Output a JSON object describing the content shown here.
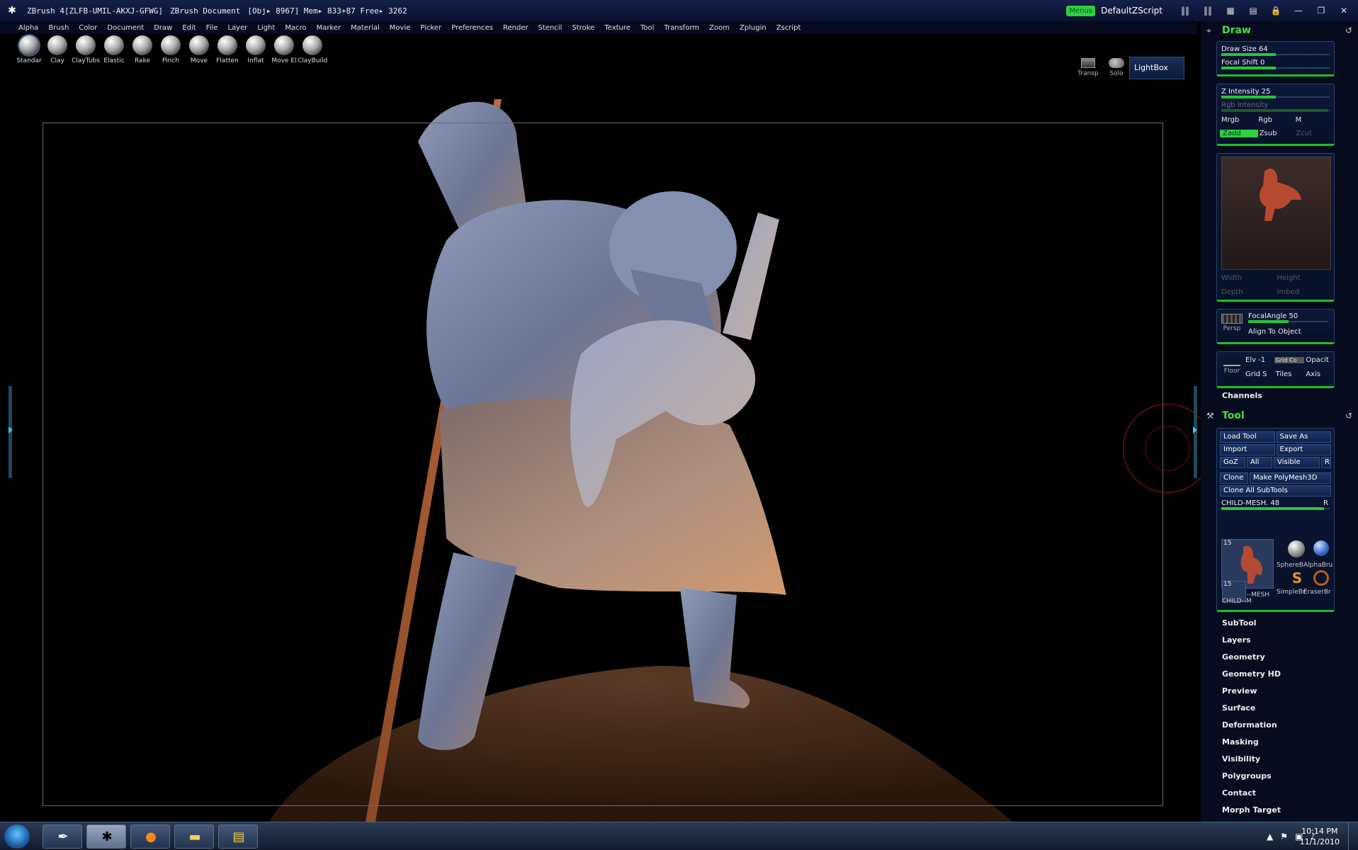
{
  "title": {
    "app": "ZBrush 4[ZLFB-UMIL-AKXJ-GFWG]",
    "doc": "ZBrush Document",
    "stats": "[Obj▸ 8967] Mem▸ 833+87 Free▸ 3262",
    "menus_badge": "Menus",
    "script": "DefaultZScript"
  },
  "menubar": [
    "Alpha",
    "Brush",
    "Color",
    "Document",
    "Draw",
    "Edit",
    "File",
    "Layer",
    "Light",
    "Macro",
    "Marker",
    "Material",
    "Movie",
    "Picker",
    "Preferences",
    "Render",
    "Stencil",
    "Stroke",
    "Texture",
    "Tool",
    "Transform",
    "Zoom",
    "Zplugin",
    "Zscript"
  ],
  "brushes": [
    "Standar",
    "Clay",
    "ClayTubs",
    "Elastic",
    "Rake",
    "Pinch",
    "Move",
    "Flatten",
    "Inflat",
    "Move El",
    "ClayBuild"
  ],
  "topbar": {
    "transp": "Transp",
    "solo": "Solo",
    "lightbox": "LightBox"
  },
  "draw": {
    "title": "Draw",
    "draw_size": "Draw Size 64",
    "draw_size_val": 0.5,
    "focal_shift": "Focal Shift 0",
    "focal_shift_val": 0.5,
    "z_intensity": "Z Intensity 25",
    "z_intensity_val": 0.5,
    "rgb_intensity": "Rgb Intensity",
    "rgb_intensity_val": 0.98,
    "mrgb": "Mrgb",
    "rgb": "Rgb",
    "m": "M",
    "zadd": "Zadd",
    "zsub": "Zsub",
    "zcut": "Zcut",
    "width": "Width",
    "height": "Height",
    "depth": "Depth",
    "imbed": "Imbed",
    "persp": "Persp",
    "focal_angle": "FocalAngle 50",
    "focal_angle_val": 0.5,
    "align": "Align To Object",
    "floor": "Floor",
    "elv": "Elv -1",
    "grid_c": "Grid Co",
    "opacity": "Opacit",
    "grid_s": "Grid S",
    "tiles": "Tiles",
    "axis": "Axis"
  },
  "channels": "Channels",
  "tool": {
    "title": "Tool",
    "load": "Load Tool",
    "save_as": "Save As",
    "import": "Import",
    "export": "Export",
    "goz": "GoZ",
    "all": "All",
    "visible": "Visible",
    "r": "R",
    "clone": "Clone",
    "make_poly": "Make PolyMesh3D",
    "clone_all": "Clone All SubTools",
    "current": "CHILD-MESH. 48",
    "current_r": "R",
    "current_val": 0.95,
    "thumbs": [
      {
        "name": "CHILD--MESH",
        "count": "15"
      },
      {
        "name": "SphereB"
      },
      {
        "name": "AlphaBru"
      },
      {
        "name": "SimpleBr"
      },
      {
        "name": "EraserBr"
      },
      {
        "name": "CHILD--M",
        "count": "15"
      }
    ]
  },
  "palettes": [
    "SubTool",
    "Layers",
    "Geometry",
    "Geometry HD",
    "Preview",
    "Surface",
    "Deformation",
    "Masking",
    "Visibility",
    "Polygroups",
    "Contact",
    "Morph Target"
  ],
  "taskbar": {
    "time": "10:14 PM",
    "date": "11/1/2010"
  },
  "icons": {
    "app": "zbrush-logo-icon",
    "pen": "pen-tool-icon",
    "browser": "firefox-icon",
    "folder": "folder-icon",
    "media": "media-player-icon"
  }
}
